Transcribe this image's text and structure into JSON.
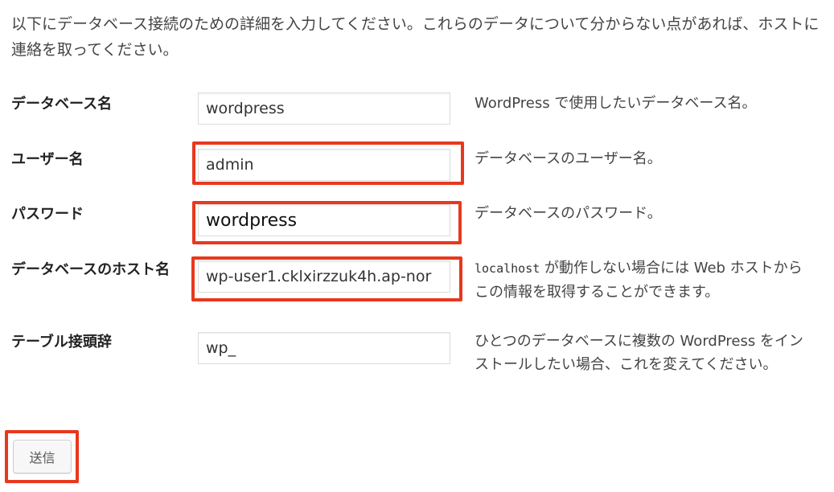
{
  "intro": "以下にデータベース接続のための詳細を入力してください。これらのデータについて分からない点があれば、ホストに連絡を取ってください。",
  "fields": [
    {
      "label": "データベース名",
      "value": "wordpress",
      "help": "WordPress で使用したいデータベース名。"
    },
    {
      "label": "ユーザー名",
      "value": "admin",
      "help": "データベースのユーザー名。"
    },
    {
      "label": "パスワード",
      "value": "wordpress",
      "help": "データベースのパスワード。"
    },
    {
      "label": "データベースのホスト名",
      "value": "wp-user1.cklxirzzuk4h.ap-nor",
      "help_code": "localhost",
      "help": " が動作しない場合には Web ホストからこの情報を取得することができます。"
    },
    {
      "label": "テーブル接頭辞",
      "value": "wp_",
      "help": "ひとつのデータベースに複数の WordPress をインストールしたい場合、これを変えてください。"
    }
  ],
  "submit_label": "送信",
  "highlight_color": "#e8381e"
}
